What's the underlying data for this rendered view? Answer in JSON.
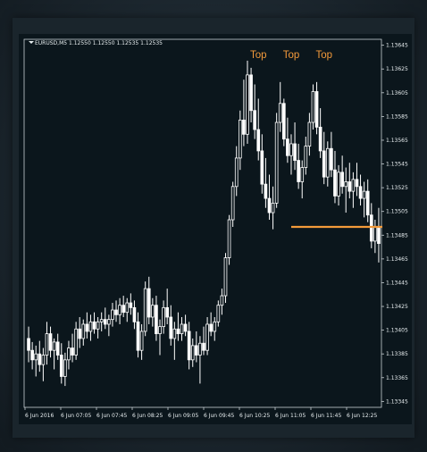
{
  "header": {
    "symbol": "EURUSD,M5",
    "ohlc": "1.12550 1.12550 1.12535 1.12535"
  },
  "colors": {
    "background": "#0b161c",
    "candles": "#ffffff",
    "axis": "#c8d0d4",
    "annotation": "#f39a3a",
    "support_line": "#f39a3a"
  },
  "chart_data": {
    "type": "candlestick",
    "symbol": "EURUSD",
    "timeframe": "M5",
    "title": "EURUSD,M5 1.12550 1.12550 1.12535 1.12535",
    "ylim": [
      1.1334,
      1.1365
    ],
    "y_ticks": [
      "1.13645",
      "1.13625",
      "1.13605",
      "1.13585",
      "1.13565",
      "1.13545",
      "1.13525",
      "1.13505",
      "1.13485",
      "1.13465",
      "1.13445",
      "1.13425",
      "1.13405",
      "1.13385",
      "1.13365",
      "1.13345"
    ],
    "x_ticks": [
      "6 Jun 2016",
      "6 Jun 07:05",
      "6 Jun 07:45",
      "6 Jun 08:25",
      "6 Jun 09:05",
      "6 Jun 09:45",
      "6 Jun 10:25",
      "6 Jun 11:05",
      "6 Jun 11:45",
      "6 Jun 12:25"
    ],
    "annotations": [
      {
        "text": "Top",
        "bar": 63
      },
      {
        "text": "Top",
        "bar": 72
      },
      {
        "text": "Top",
        "bar": 81
      }
    ],
    "support_line": {
      "price": 1.13492,
      "from_bar": 72,
      "to_bar": 97
    },
    "candles": [
      [
        1.13398,
        1.13408,
        1.13378,
        1.13388
      ],
      [
        1.13388,
        1.13395,
        1.13372,
        1.1338
      ],
      [
        1.1338,
        1.13392,
        1.13366,
        1.13385
      ],
      [
        1.13385,
        1.13396,
        1.1337,
        1.13376
      ],
      [
        1.13376,
        1.1339,
        1.13362,
        1.13384
      ],
      [
        1.13384,
        1.13412,
        1.13376,
        1.13402
      ],
      [
        1.13402,
        1.13408,
        1.13382,
        1.13388
      ],
      [
        1.13388,
        1.13398,
        1.13372,
        1.13395
      ],
      [
        1.13395,
        1.13402,
        1.1338,
        1.13384
      ],
      [
        1.13384,
        1.13394,
        1.1336,
        1.13366
      ],
      [
        1.13366,
        1.13386,
        1.13358,
        1.1338
      ],
      [
        1.1338,
        1.13396,
        1.13372,
        1.1339
      ],
      [
        1.1339,
        1.13402,
        1.13378,
        1.13384
      ],
      [
        1.13384,
        1.13412,
        1.1338,
        1.13406
      ],
      [
        1.13406,
        1.13416,
        1.1339,
        1.13398
      ],
      [
        1.13398,
        1.13414,
        1.13392,
        1.1341
      ],
      [
        1.1341,
        1.1342,
        1.13398,
        1.13404
      ],
      [
        1.13404,
        1.13418,
        1.13396,
        1.13412
      ],
      [
        1.13412,
        1.1342,
        1.13402,
        1.13406
      ],
      [
        1.13406,
        1.13416,
        1.13398,
        1.13412
      ],
      [
        1.13412,
        1.1342,
        1.13404,
        1.13414
      ],
      [
        1.13414,
        1.13424,
        1.13406,
        1.1341
      ],
      [
        1.1341,
        1.13418,
        1.134,
        1.13414
      ],
      [
        1.13414,
        1.13428,
        1.13408,
        1.13422
      ],
      [
        1.13422,
        1.1343,
        1.13412,
        1.13418
      ],
      [
        1.13418,
        1.13432,
        1.1341,
        1.13426
      ],
      [
        1.13426,
        1.13434,
        1.13416,
        1.1342
      ],
      [
        1.1342,
        1.13432,
        1.13412,
        1.13428
      ],
      [
        1.13428,
        1.13436,
        1.13418,
        1.13424
      ],
      [
        1.13424,
        1.1343,
        1.13406,
        1.13412
      ],
      [
        1.13412,
        1.1342,
        1.13382,
        1.13388
      ],
      [
        1.13388,
        1.1341,
        1.1338,
        1.13404
      ],
      [
        1.13404,
        1.13446,
        1.134,
        1.1344
      ],
      [
        1.1344,
        1.1345,
        1.1341,
        1.13416
      ],
      [
        1.13416,
        1.13432,
        1.13408,
        1.13426
      ],
      [
        1.13426,
        1.13434,
        1.13396,
        1.13402
      ],
      [
        1.13402,
        1.13414,
        1.13384,
        1.13408
      ],
      [
        1.13408,
        1.1343,
        1.13402,
        1.13424
      ],
      [
        1.13424,
        1.1344,
        1.1341,
        1.13416
      ],
      [
        1.13416,
        1.13426,
        1.13392,
        1.13398
      ],
      [
        1.13398,
        1.13412,
        1.1338,
        1.13406
      ],
      [
        1.13406,
        1.1342,
        1.13396,
        1.13402
      ],
      [
        1.13402,
        1.13416,
        1.13396,
        1.1341
      ],
      [
        1.1341,
        1.13418,
        1.134,
        1.13404
      ],
      [
        1.13404,
        1.13412,
        1.13372,
        1.1338
      ],
      [
        1.1338,
        1.13398,
        1.13374,
        1.13392
      ],
      [
        1.13392,
        1.13404,
        1.13378,
        1.13384
      ],
      [
        1.13384,
        1.134,
        1.1336,
        1.13394
      ],
      [
        1.13394,
        1.13408,
        1.13384,
        1.13388
      ],
      [
        1.13388,
        1.13416,
        1.13384,
        1.1341
      ],
      [
        1.1341,
        1.1342,
        1.134,
        1.13404
      ],
      [
        1.13404,
        1.13416,
        1.13396,
        1.13412
      ],
      [
        1.13412,
        1.1343,
        1.13408,
        1.13426
      ],
      [
        1.13426,
        1.1344,
        1.13418,
        1.13434
      ],
      [
        1.13434,
        1.1347,
        1.13428,
        1.13466
      ],
      [
        1.13466,
        1.13502,
        1.1346,
        1.13498
      ],
      [
        1.13498,
        1.1353,
        1.13492,
        1.13526
      ],
      [
        1.13526,
        1.1356,
        1.13518,
        1.1355
      ],
      [
        1.1355,
        1.1359,
        1.1354,
        1.13582
      ],
      [
        1.13582,
        1.13616,
        1.1356,
        1.1357
      ],
      [
        1.1357,
        1.13632,
        1.13562,
        1.1362
      ],
      [
        1.1362,
        1.13626,
        1.1358,
        1.1359
      ],
      [
        1.1359,
        1.13612,
        1.13566,
        1.13574
      ],
      [
        1.13574,
        1.136,
        1.13548,
        1.13556
      ],
      [
        1.13556,
        1.1357,
        1.1352,
        1.13528
      ],
      [
        1.13528,
        1.1355,
        1.13508,
        1.13516
      ],
      [
        1.13516,
        1.13536,
        1.13498,
        1.13504
      ],
      [
        1.13504,
        1.13526,
        1.1349,
        1.13512
      ],
      [
        1.13512,
        1.13588,
        1.13508,
        1.1358
      ],
      [
        1.1358,
        1.13614,
        1.13572,
        1.13596
      ],
      [
        1.13596,
        1.136,
        1.1356,
        1.13566
      ],
      [
        1.13566,
        1.13584,
        1.13546,
        1.13552
      ],
      [
        1.13552,
        1.1357,
        1.13536,
        1.13562
      ],
      [
        1.13562,
        1.1358,
        1.1354,
        1.13548
      ],
      [
        1.13548,
        1.13562,
        1.13524,
        1.1353
      ],
      [
        1.1353,
        1.13548,
        1.13516,
        1.13542
      ],
      [
        1.13542,
        1.13568,
        1.13536,
        1.1356
      ],
      [
        1.1356,
        1.13588,
        1.13552,
        1.1358
      ],
      [
        1.1358,
        1.13612,
        1.13574,
        1.13606
      ],
      [
        1.13606,
        1.13614,
        1.1357,
        1.13576
      ],
      [
        1.13576,
        1.13592,
        1.1355,
        1.13556
      ],
      [
        1.13556,
        1.13572,
        1.13528,
        1.13534
      ],
      [
        1.13534,
        1.13564,
        1.13526,
        1.13558
      ],
      [
        1.13558,
        1.13572,
        1.13534,
        1.1354
      ],
      [
        1.1354,
        1.13556,
        1.13512,
        1.13518
      ],
      [
        1.13518,
        1.13544,
        1.1351,
        1.13538
      ],
      [
        1.13538,
        1.13552,
        1.1352,
        1.13526
      ],
      [
        1.13526,
        1.13542,
        1.13504,
        1.1353
      ],
      [
        1.1353,
        1.13546,
        1.13516,
        1.13522
      ],
      [
        1.13522,
        1.13538,
        1.13508,
        1.13532
      ],
      [
        1.13532,
        1.13546,
        1.13518,
        1.13526
      ],
      [
        1.13526,
        1.13536,
        1.1351,
        1.13516
      ],
      [
        1.13516,
        1.1353,
        1.135,
        1.13522
      ],
      [
        1.13522,
        1.13532,
        1.13496,
        1.13502
      ],
      [
        1.13502,
        1.13512,
        1.13474,
        1.1348
      ],
      [
        1.1348,
        1.13498,
        1.1347,
        1.13492
      ],
      [
        1.13492,
        1.13508,
        1.13462,
        1.13478
      ]
    ]
  }
}
